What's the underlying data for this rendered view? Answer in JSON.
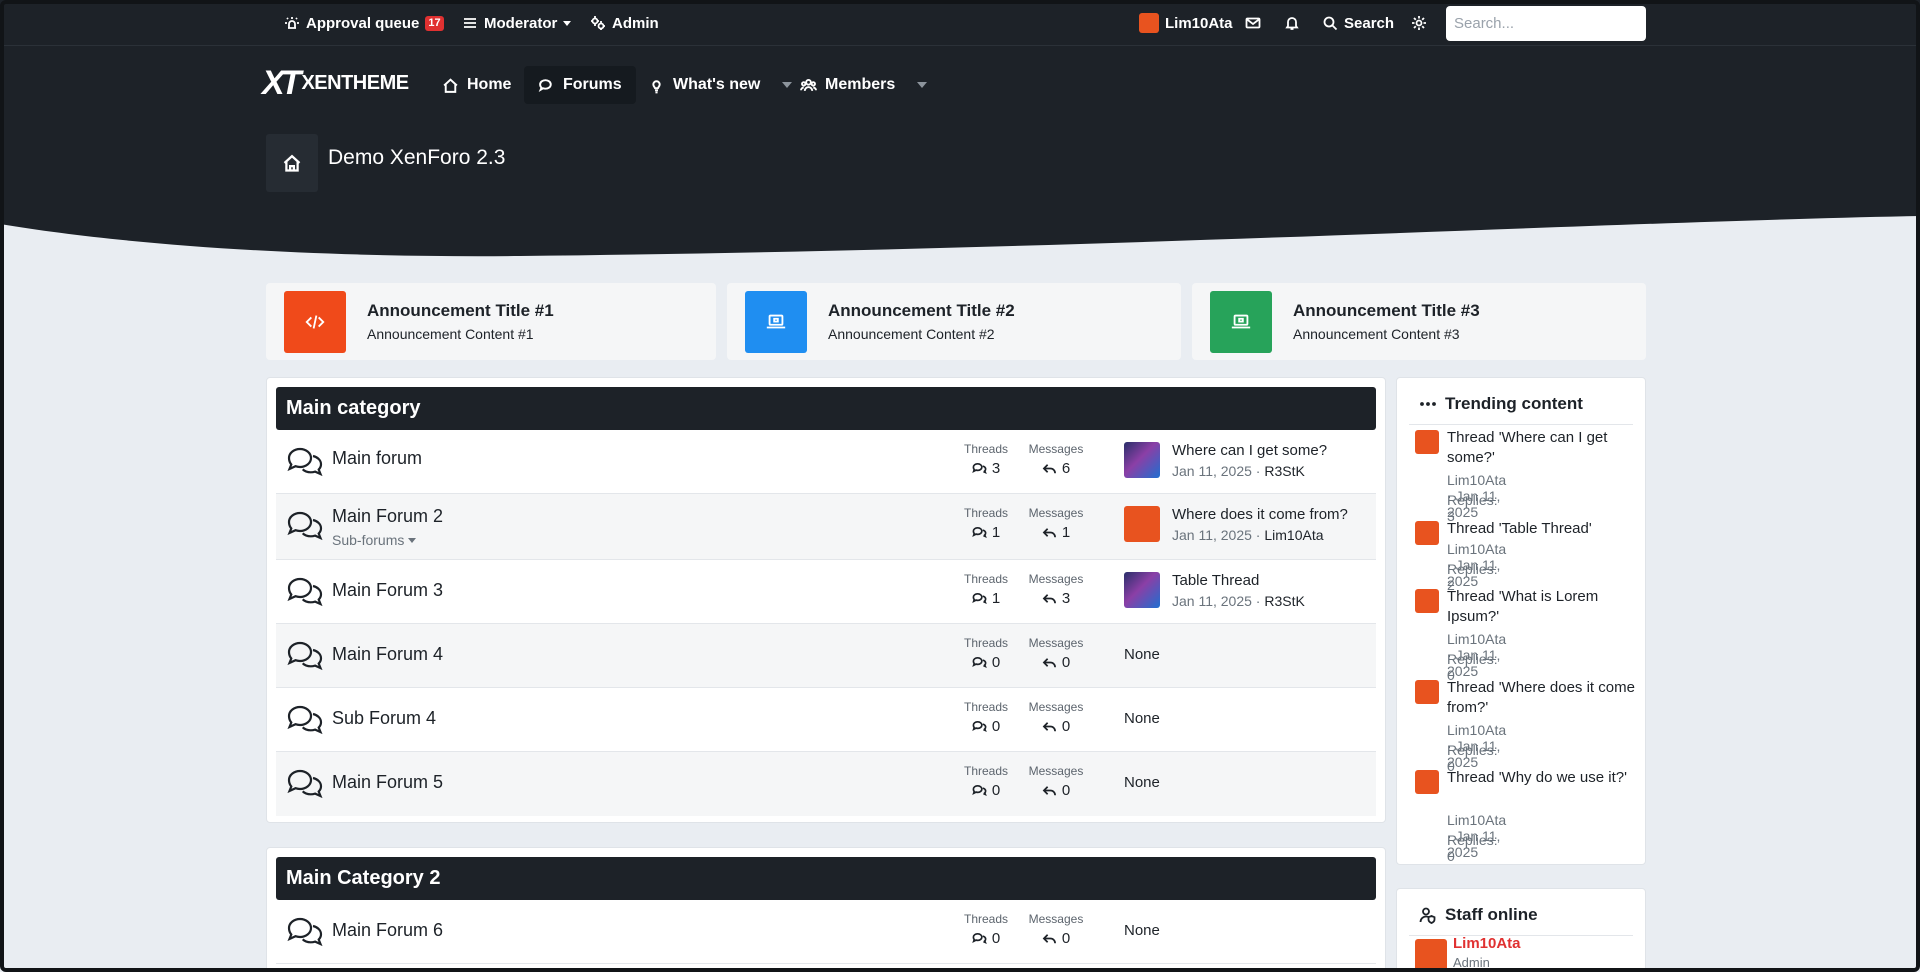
{
  "topbar": {
    "approval_label": "Approval queue",
    "approval_count": "17",
    "moderator_label": "Moderator",
    "admin_label": "Admin",
    "user_name": "Lim10Ata",
    "search_label": "Search",
    "search_placeholder": "Search..."
  },
  "nav": {
    "logo_mark": "XT",
    "logo_text": "XENTHEME",
    "items": [
      {
        "label": "Home"
      },
      {
        "label": "Forums"
      },
      {
        "label": "What's new"
      },
      {
        "label": "Members"
      }
    ]
  },
  "header": {
    "title": "Demo XenForo 2.3"
  },
  "announcements": [
    {
      "title": "Announcement Title #1",
      "content": "Announcement Content #1",
      "color": "#f04a1a"
    },
    {
      "title": "Announcement Title #2",
      "content": "Announcement Content #2",
      "color": "#1f8ef1"
    },
    {
      "title": "Announcement Title #3",
      "content": "Announcement Content #3",
      "color": "#27a35a"
    }
  ],
  "labels": {
    "threads": "Threads",
    "messages": "Messages",
    "none": "None",
    "sub_forums": "Sub-forums"
  },
  "categories": [
    {
      "title": "Main category",
      "forums": [
        {
          "name": "Main forum",
          "threads": "3",
          "messages": "6",
          "last_title": "Where can I get some?",
          "last_date": "Jan 11, 2025",
          "last_user": "R3StK"
        },
        {
          "name": "Main Forum 2",
          "threads": "1",
          "messages": "1",
          "last_title": "Where does it come from?",
          "last_date": "Jan 11, 2025",
          "last_user": "Lim10Ata"
        },
        {
          "name": "Main Forum 3",
          "threads": "1",
          "messages": "3",
          "last_title": "Table Thread",
          "last_date": "Jan 11, 2025",
          "last_user": "R3StK"
        },
        {
          "name": "Main Forum 4",
          "threads": "0",
          "messages": "0"
        },
        {
          "name": "Sub Forum 4",
          "threads": "0",
          "messages": "0"
        },
        {
          "name": "Main Forum 5",
          "threads": "0",
          "messages": "0"
        }
      ]
    },
    {
      "title": "Main Category 2",
      "forums": [
        {
          "name": "Main Forum 6",
          "threads": "0",
          "messages": "0"
        }
      ]
    }
  ],
  "sidebar": {
    "trending_title": "Trending content",
    "trending": [
      {
        "title": "Thread 'Where can I get some?'",
        "user": "Lim10Ata",
        "date": "Jan 11, 2025",
        "replies": "Replies: 3"
      },
      {
        "title": "Thread 'Table Thread'",
        "user": "Lim10Ata",
        "date": "Jan 11, 2025",
        "replies": "Replies: 2"
      },
      {
        "title": "Thread 'What is Lorem Ipsum?'",
        "user": "Lim10Ata",
        "date": "Jan 11, 2025",
        "replies": "Replies: 0"
      },
      {
        "title": "Thread 'Where does it come from?'",
        "user": "Lim10Ata",
        "date": "Jan 11, 2025",
        "replies": "Replies: 0"
      },
      {
        "title": "Thread 'Why do we use it?'",
        "user": "Lim10Ata",
        "date": "Jan 11, 2025",
        "replies": "Replies: 0"
      }
    ],
    "staff_title": "Staff online",
    "staff_name": "Lim10Ata",
    "staff_role": "Admin"
  },
  "colors": {
    "dark": "#1d2228",
    "page_bg": "#e9edf2",
    "badge": "#e03131",
    "staff_name": "#e03131"
  }
}
